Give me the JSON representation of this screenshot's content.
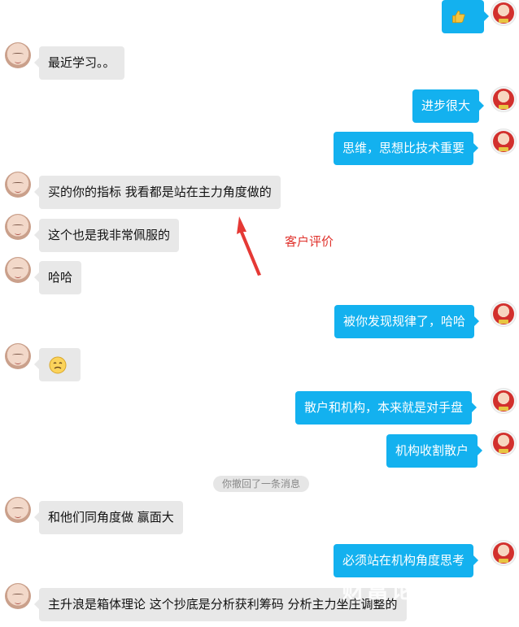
{
  "messages": [
    {
      "side": "right",
      "type": "emoji",
      "emoji": "thumbs-up"
    },
    {
      "side": "left",
      "text": "最近学习。。"
    },
    {
      "side": "right",
      "text": "进步很大"
    },
    {
      "side": "right",
      "text": "思维，思想比技术重要"
    },
    {
      "side": "left",
      "text": "买的你的指标 我看都是站在主力角度做的"
    },
    {
      "side": "left",
      "text": "这个也是我非常佩服的"
    },
    {
      "side": "left",
      "text": "哈哈"
    },
    {
      "side": "right",
      "text": "被你发现规律了，哈哈"
    },
    {
      "side": "left",
      "type": "emoji",
      "emoji": "smiley"
    },
    {
      "side": "right",
      "text": "散户和机构，本来就是对手盘"
    },
    {
      "side": "right",
      "text": "机构收割散户"
    },
    {
      "side": "left",
      "text": "和他们同角度做 赢面大"
    },
    {
      "side": "right",
      "text": "必须站在机构角度思考"
    },
    {
      "side": "left",
      "text": "主升浪是箱体理论 这个抄底是分析获利筹码 分析主力坐庄调整的"
    }
  ],
  "system_notice": "你撤回了一条消息",
  "annotation": {
    "text": "客户评价",
    "color": "#e0322c"
  },
  "colors": {
    "right_bubble": "#13b1ef",
    "left_bubble": "#e8e8e8"
  }
}
